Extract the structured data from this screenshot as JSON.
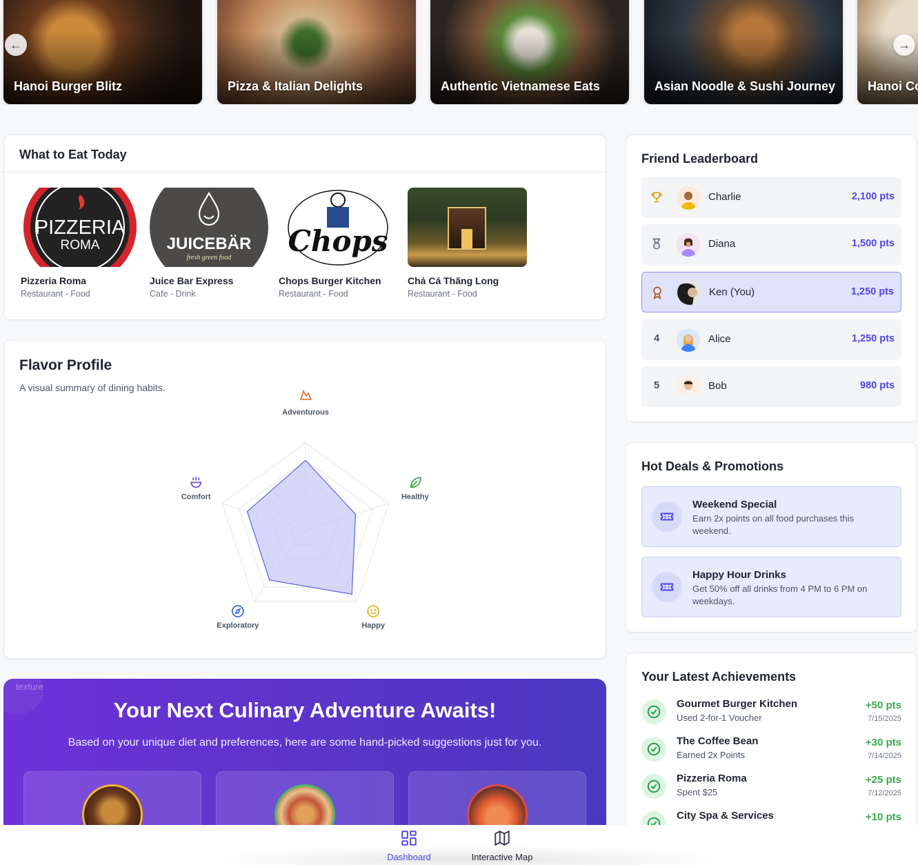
{
  "carousel": {
    "cards": [
      {
        "title": "Hanoi Burger Blitz"
      },
      {
        "title": "Pizza & Italian Delights"
      },
      {
        "title": "Authentic Vietnamese Eats"
      },
      {
        "title": "Asian Noodle & Sushi Journey"
      },
      {
        "title": "Hanoi Co"
      }
    ],
    "prev_icon": "arrow-left-icon",
    "next_icon": "arrow-right-icon"
  },
  "what_to_eat": {
    "title": "What to Eat Today",
    "venues": [
      {
        "name": "Pizzeria Roma",
        "category": "Restaurant - Food",
        "logo_line1": "PIZZERIA",
        "logo_line2": "ROMA"
      },
      {
        "name": "Juice Bar Express",
        "category": "Cafe - Drink",
        "logo_line1": "JUICEBÄR",
        "logo_line2": "fresh green food"
      },
      {
        "name": "Chops Burger Kitchen",
        "category": "Restaurant - Food",
        "logo_line1": "Chops"
      },
      {
        "name": "Chả Cá Thăng Long",
        "category": "Restaurant - Food"
      }
    ]
  },
  "flavor_profile": {
    "title": "Flavor Profile",
    "subtitle": "A visual summary of dining habits.",
    "axes": [
      {
        "label": "Adventurous",
        "value": 0.8,
        "icon": "mountain-icon",
        "color": "#e07b39"
      },
      {
        "label": "Healthy",
        "value": 0.6,
        "icon": "leaf-icon",
        "color": "#3aa84c"
      },
      {
        "label": "Happy",
        "value": 0.9,
        "icon": "smile-icon",
        "color": "#e6b422"
      },
      {
        "label": "Exploratory",
        "value": 0.7,
        "icon": "compass-icon",
        "color": "#3b6fd4"
      },
      {
        "label": "Comfort",
        "value": 0.7,
        "icon": "bowl-icon",
        "color": "#6b4fe0"
      }
    ],
    "fill_color": "#c7caf6",
    "stroke_color": "#5b5fe6"
  },
  "promo": {
    "texture_label": "texture",
    "title": "Your Next Culinary Adventure Awaits!",
    "subtitle": "Based on your unique diet and preferences, here are some hand-picked suggestions just for you."
  },
  "leaderboard": {
    "title": "Friend Leaderboard",
    "rows": [
      {
        "rank": "",
        "rank_icon": "trophy-icon",
        "name": "Charlie",
        "points": "2,100 pts"
      },
      {
        "rank": "",
        "rank_icon": "medal-icon",
        "name": "Diana",
        "points": "1,500 pts"
      },
      {
        "rank": "",
        "rank_icon": "award-icon",
        "name": "Ken (You)",
        "points": "1,250 pts"
      },
      {
        "rank": "4",
        "name": "Alice",
        "points": "1,250 pts"
      },
      {
        "rank": "5",
        "name": "Bob",
        "points": "980 pts"
      }
    ]
  },
  "deals": {
    "title": "Hot Deals & Promotions",
    "items": [
      {
        "name": "Weekend Special",
        "description": "Earn 2x points on all food purchases this weekend."
      },
      {
        "name": "Happy Hour Drinks",
        "description": "Get 50% off all drinks from 4 PM to 6 PM on weekdays."
      }
    ]
  },
  "achievements": {
    "title": "Your Latest Achievements",
    "items": [
      {
        "name": "Gourmet Burger Kitchen",
        "detail": "Used 2-for-1 Voucher",
        "points": "+50 pts",
        "date": "7/15/2025"
      },
      {
        "name": "The Coffee Bean",
        "detail": "Earned 2x Points",
        "points": "+30 pts",
        "date": "7/14/2025"
      },
      {
        "name": "Pizzeria Roma",
        "detail": "Spent $25",
        "points": "+25 pts",
        "date": "7/12/2025"
      },
      {
        "name": "City Spa & Services",
        "detail": "",
        "points": "+10 pts",
        "date": ""
      }
    ]
  },
  "bottom_nav": {
    "items": [
      {
        "label": "Dashboard",
        "icon": "dashboard-icon",
        "active": true
      },
      {
        "label": "Interactive Map",
        "icon": "map-icon",
        "active": false
      }
    ],
    "active_color": "#4f46e5"
  }
}
